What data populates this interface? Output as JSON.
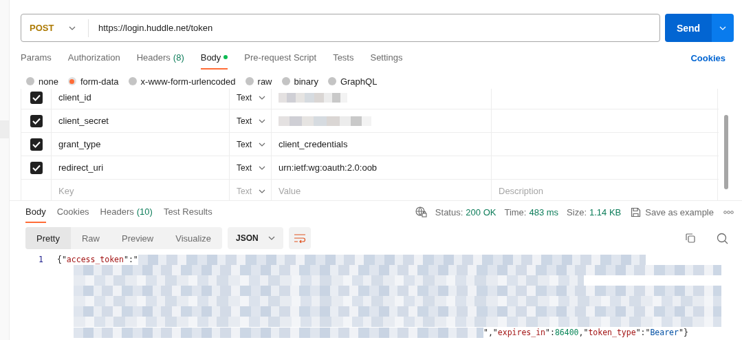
{
  "request": {
    "method": "POST",
    "url": "https://login.huddle.net/token",
    "send": "Send"
  },
  "request_tabs": [
    {
      "label": "Params",
      "selected": false
    },
    {
      "label": "Authorization",
      "selected": false
    },
    {
      "label": "Headers",
      "count": "(8)",
      "selected": false
    },
    {
      "label": "Body",
      "selected": true,
      "dot": true
    },
    {
      "label": "Pre-request Script",
      "selected": false
    },
    {
      "label": "Tests",
      "selected": false
    },
    {
      "label": "Settings",
      "selected": false
    }
  ],
  "cookies_link": "Cookies",
  "body_types": [
    {
      "label": "none",
      "selected": false
    },
    {
      "label": "form-data",
      "selected": true
    },
    {
      "label": "x-www-form-urlencoded",
      "selected": false
    },
    {
      "label": "raw",
      "selected": false
    },
    {
      "label": "binary",
      "selected": false
    },
    {
      "label": "GraphQL",
      "selected": false
    }
  ],
  "form_rows": [
    {
      "checked": true,
      "key": "client_id",
      "type": "Text",
      "redacted": true
    },
    {
      "checked": true,
      "key": "client_secret",
      "type": "Text",
      "redacted": true
    },
    {
      "checked": true,
      "key": "grant_type",
      "type": "Text",
      "value": "client_credentials"
    },
    {
      "checked": true,
      "key": "redirect_uri",
      "type": "Text",
      "value": "urn:ietf:wg:oauth:2.0:oob"
    }
  ],
  "new_row": {
    "key_placeholder": "Key",
    "type": "Text",
    "value_placeholder": "Value",
    "description_placeholder": "Description"
  },
  "response": {
    "tabs": [
      {
        "label": "Body",
        "selected": true
      },
      {
        "label": "Cookies",
        "selected": false
      },
      {
        "label": "Headers",
        "count": "(10)",
        "selected": false
      },
      {
        "label": "Test Results",
        "selected": false
      }
    ],
    "stats": [
      {
        "label": "Status:",
        "value": "200 OK"
      },
      {
        "label": "Time:",
        "value": "483 ms"
      },
      {
        "label": "Size:",
        "value": "1.14 KB"
      }
    ],
    "save": "Save as example",
    "view_modes": [
      {
        "label": "Pretty",
        "selected": true
      },
      {
        "label": "Raw",
        "selected": false
      },
      {
        "label": "Preview",
        "selected": false
      },
      {
        "label": "Visualize",
        "selected": false
      }
    ],
    "format": "JSON",
    "line_number": "1",
    "code_start": [
      {
        "kind": "punct",
        "text": "{\""
      },
      {
        "kind": "key",
        "text": "access_token"
      },
      {
        "kind": "punct",
        "text": "\":\""
      }
    ],
    "code_end": [
      {
        "kind": "punct",
        "text": "\",\""
      },
      {
        "kind": "key",
        "text": "expires_in"
      },
      {
        "kind": "punct",
        "text": "\":"
      },
      {
        "kind": "number",
        "text": "86400"
      },
      {
        "kind": "punct",
        "text": ",\""
      },
      {
        "kind": "key",
        "text": "token_type"
      },
      {
        "kind": "punct",
        "text": "\":\""
      },
      {
        "kind": "string",
        "text": "Bearer"
      },
      {
        "kind": "punct",
        "text": "\"}"
      }
    ]
  }
}
